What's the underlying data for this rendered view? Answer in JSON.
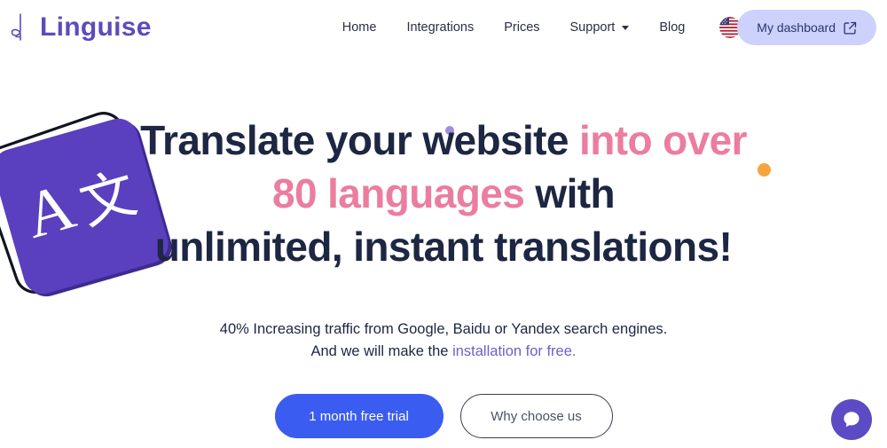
{
  "brand": {
    "name": "Linguise",
    "logo_icon": "linguise-leaf-icon",
    "color": "#5c4bbd"
  },
  "nav": {
    "items": [
      {
        "label": "Home",
        "has_dropdown": false
      },
      {
        "label": "Integrations",
        "has_dropdown": false
      },
      {
        "label": "Prices",
        "has_dropdown": false
      },
      {
        "label": "Support",
        "has_dropdown": true
      },
      {
        "label": "Blog",
        "has_dropdown": false
      }
    ],
    "language_flag": "us-flag-icon"
  },
  "dashboard_button": {
    "label": "My dashboard",
    "icon": "external-link-icon",
    "bg_color": "#ccd2fb",
    "text_color": "#2b3470"
  },
  "hero": {
    "illustration": {
      "name": "translation-card-illustration",
      "latin_glyph": "A",
      "cjk_glyph": "文",
      "card_color": "#5a3fbf"
    },
    "headline": {
      "line1_part1": "Translate your website ",
      "line1_part2": "into over",
      "line2_part1": "80 languages",
      "line2_part2": " with",
      "line3": "unlimited, instant translations!",
      "dark_color": "#1d2642",
      "accent_color": "#eb7d9f"
    },
    "subtitle": {
      "line1": "40% Increasing traffic from Google, Baidu or Yandex search engines.",
      "line2_text": "And we will make the ",
      "line2_link": "installation for free.",
      "link_color": "#6f5fc4"
    },
    "cta": {
      "primary_label": "1 month free trial",
      "primary_color": "#3b5cf0",
      "secondary_label": "Why choose us"
    },
    "decorations": {
      "purple_dot_color": "#9d8fe0",
      "orange_dot_color": "#f5a43f"
    }
  },
  "chat_widget": {
    "icon": "chat-bubble-icon",
    "color": "#5b4bc4"
  }
}
